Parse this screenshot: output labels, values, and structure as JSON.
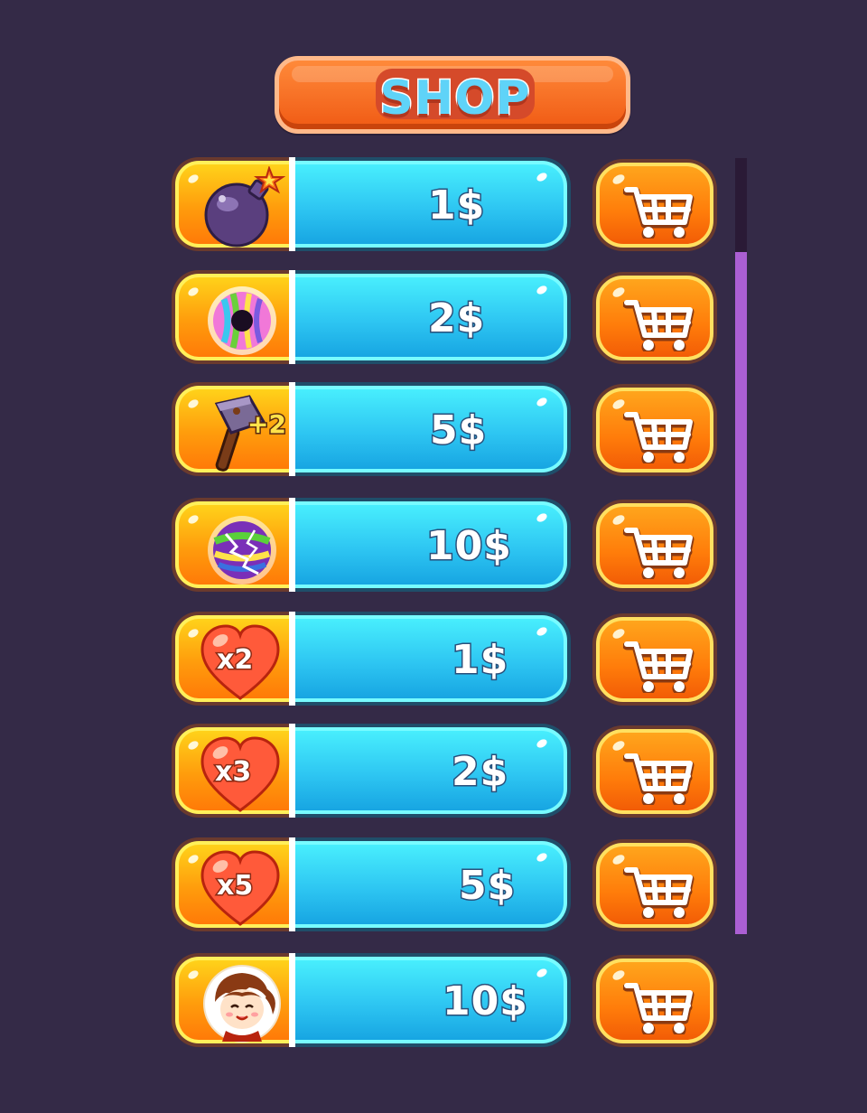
{
  "title": "SHOP",
  "items": [
    {
      "icon": "bomb-icon",
      "price": "1$",
      "badge": ""
    },
    {
      "icon": "rainbow-donut-icon",
      "price": "2$",
      "badge": ""
    },
    {
      "icon": "hammer-icon",
      "price": "5$",
      "badge": "+2"
    },
    {
      "icon": "lightning-ball-icon",
      "price": "10$",
      "badge": ""
    },
    {
      "icon": "heart-icon",
      "price": "1$",
      "badge": "x2"
    },
    {
      "icon": "heart-icon",
      "price": "2$",
      "badge": "x3"
    },
    {
      "icon": "heart-icon",
      "price": "5$",
      "badge": "x5"
    },
    {
      "icon": "character-avatar-icon",
      "price": "10$",
      "badge": ""
    }
  ],
  "colors": {
    "background": "#342a47",
    "title": "#5fd3f8",
    "price_panel": "#2ec6f2",
    "icon_panel": "#ff9c0c",
    "cart_button": "#ff7c0a",
    "scrollbar": "#ab5fd3"
  }
}
